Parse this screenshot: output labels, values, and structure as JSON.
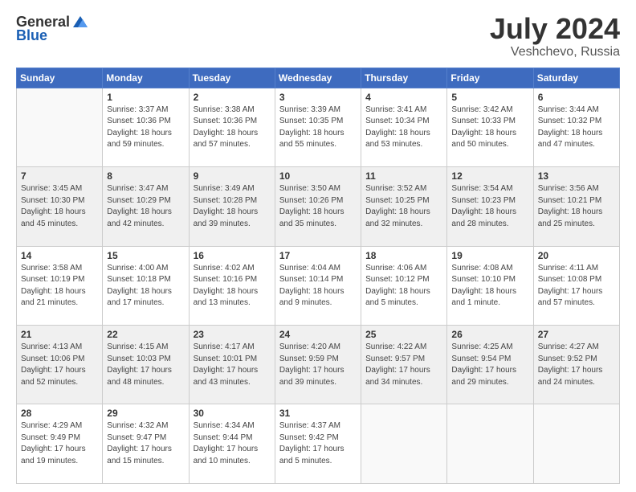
{
  "logo": {
    "general": "General",
    "blue": "Blue"
  },
  "header": {
    "month_year": "July 2024",
    "location": "Veshchevo, Russia"
  },
  "days_of_week": [
    "Sunday",
    "Monday",
    "Tuesday",
    "Wednesday",
    "Thursday",
    "Friday",
    "Saturday"
  ],
  "weeks": [
    [
      {
        "day": "",
        "detail": ""
      },
      {
        "day": "1",
        "detail": "Sunrise: 3:37 AM\nSunset: 10:36 PM\nDaylight: 18 hours\nand 59 minutes."
      },
      {
        "day": "2",
        "detail": "Sunrise: 3:38 AM\nSunset: 10:36 PM\nDaylight: 18 hours\nand 57 minutes."
      },
      {
        "day": "3",
        "detail": "Sunrise: 3:39 AM\nSunset: 10:35 PM\nDaylight: 18 hours\nand 55 minutes."
      },
      {
        "day": "4",
        "detail": "Sunrise: 3:41 AM\nSunset: 10:34 PM\nDaylight: 18 hours\nand 53 minutes."
      },
      {
        "day": "5",
        "detail": "Sunrise: 3:42 AM\nSunset: 10:33 PM\nDaylight: 18 hours\nand 50 minutes."
      },
      {
        "day": "6",
        "detail": "Sunrise: 3:44 AM\nSunset: 10:32 PM\nDaylight: 18 hours\nand 47 minutes."
      }
    ],
    [
      {
        "day": "7",
        "detail": "Sunrise: 3:45 AM\nSunset: 10:30 PM\nDaylight: 18 hours\nand 45 minutes."
      },
      {
        "day": "8",
        "detail": "Sunrise: 3:47 AM\nSunset: 10:29 PM\nDaylight: 18 hours\nand 42 minutes."
      },
      {
        "day": "9",
        "detail": "Sunrise: 3:49 AM\nSunset: 10:28 PM\nDaylight: 18 hours\nand 39 minutes."
      },
      {
        "day": "10",
        "detail": "Sunrise: 3:50 AM\nSunset: 10:26 PM\nDaylight: 18 hours\nand 35 minutes."
      },
      {
        "day": "11",
        "detail": "Sunrise: 3:52 AM\nSunset: 10:25 PM\nDaylight: 18 hours\nand 32 minutes."
      },
      {
        "day": "12",
        "detail": "Sunrise: 3:54 AM\nSunset: 10:23 PM\nDaylight: 18 hours\nand 28 minutes."
      },
      {
        "day": "13",
        "detail": "Sunrise: 3:56 AM\nSunset: 10:21 PM\nDaylight: 18 hours\nand 25 minutes."
      }
    ],
    [
      {
        "day": "14",
        "detail": "Sunrise: 3:58 AM\nSunset: 10:19 PM\nDaylight: 18 hours\nand 21 minutes."
      },
      {
        "day": "15",
        "detail": "Sunrise: 4:00 AM\nSunset: 10:18 PM\nDaylight: 18 hours\nand 17 minutes."
      },
      {
        "day": "16",
        "detail": "Sunrise: 4:02 AM\nSunset: 10:16 PM\nDaylight: 18 hours\nand 13 minutes."
      },
      {
        "day": "17",
        "detail": "Sunrise: 4:04 AM\nSunset: 10:14 PM\nDaylight: 18 hours\nand 9 minutes."
      },
      {
        "day": "18",
        "detail": "Sunrise: 4:06 AM\nSunset: 10:12 PM\nDaylight: 18 hours\nand 5 minutes."
      },
      {
        "day": "19",
        "detail": "Sunrise: 4:08 AM\nSunset: 10:10 PM\nDaylight: 18 hours\nand 1 minute."
      },
      {
        "day": "20",
        "detail": "Sunrise: 4:11 AM\nSunset: 10:08 PM\nDaylight: 17 hours\nand 57 minutes."
      }
    ],
    [
      {
        "day": "21",
        "detail": "Sunrise: 4:13 AM\nSunset: 10:06 PM\nDaylight: 17 hours\nand 52 minutes."
      },
      {
        "day": "22",
        "detail": "Sunrise: 4:15 AM\nSunset: 10:03 PM\nDaylight: 17 hours\nand 48 minutes."
      },
      {
        "day": "23",
        "detail": "Sunrise: 4:17 AM\nSunset: 10:01 PM\nDaylight: 17 hours\nand 43 minutes."
      },
      {
        "day": "24",
        "detail": "Sunrise: 4:20 AM\nSunset: 9:59 PM\nDaylight: 17 hours\nand 39 minutes."
      },
      {
        "day": "25",
        "detail": "Sunrise: 4:22 AM\nSunset: 9:57 PM\nDaylight: 17 hours\nand 34 minutes."
      },
      {
        "day": "26",
        "detail": "Sunrise: 4:25 AM\nSunset: 9:54 PM\nDaylight: 17 hours\nand 29 minutes."
      },
      {
        "day": "27",
        "detail": "Sunrise: 4:27 AM\nSunset: 9:52 PM\nDaylight: 17 hours\nand 24 minutes."
      }
    ],
    [
      {
        "day": "28",
        "detail": "Sunrise: 4:29 AM\nSunset: 9:49 PM\nDaylight: 17 hours\nand 19 minutes."
      },
      {
        "day": "29",
        "detail": "Sunrise: 4:32 AM\nSunset: 9:47 PM\nDaylight: 17 hours\nand 15 minutes."
      },
      {
        "day": "30",
        "detail": "Sunrise: 4:34 AM\nSunset: 9:44 PM\nDaylight: 17 hours\nand 10 minutes."
      },
      {
        "day": "31",
        "detail": "Sunrise: 4:37 AM\nSunset: 9:42 PM\nDaylight: 17 hours\nand 5 minutes."
      },
      {
        "day": "",
        "detail": ""
      },
      {
        "day": "",
        "detail": ""
      },
      {
        "day": "",
        "detail": ""
      }
    ]
  ]
}
